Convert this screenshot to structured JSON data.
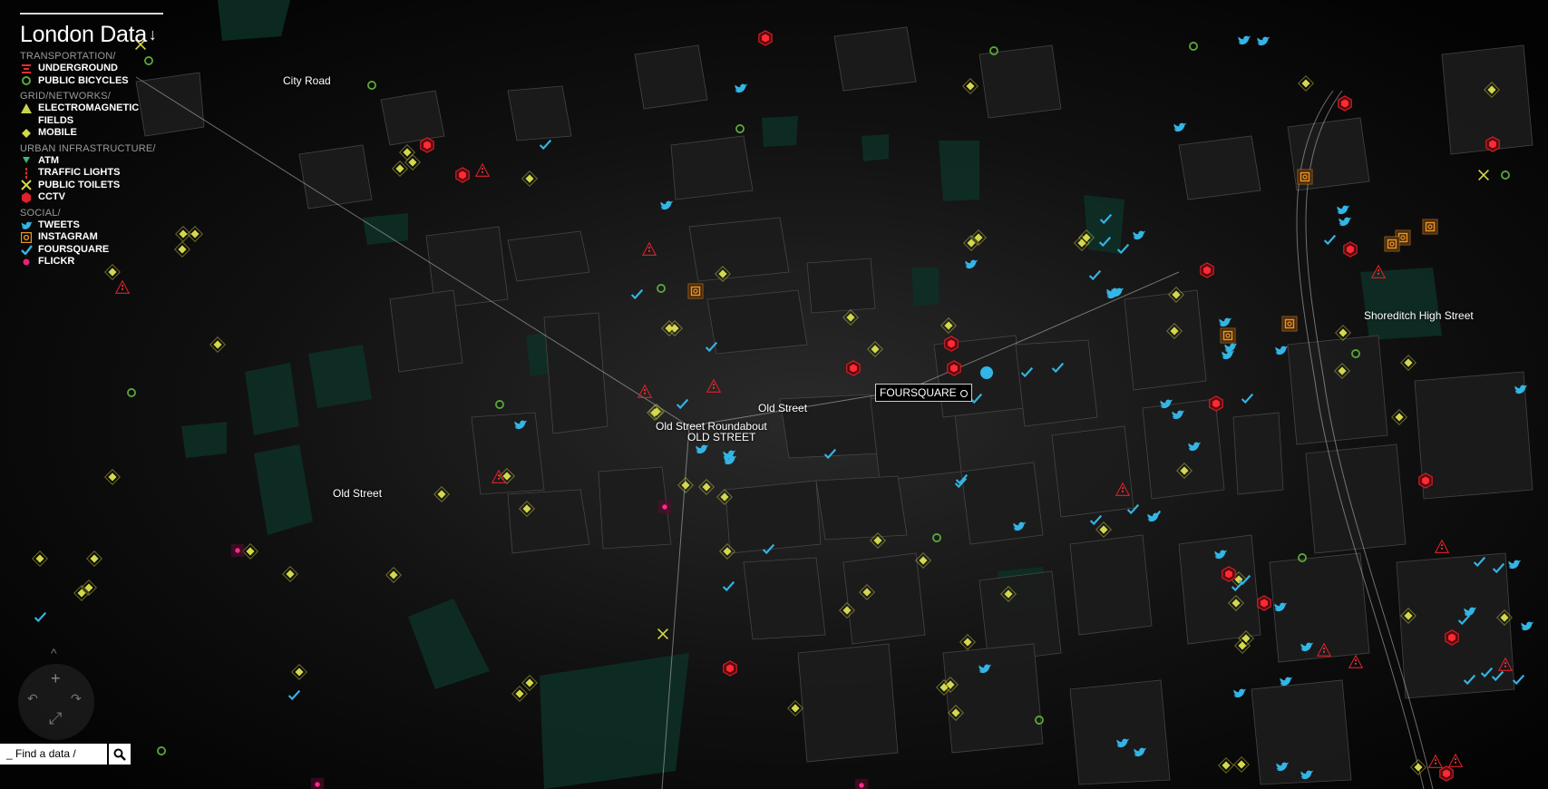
{
  "title": "London Data",
  "title_arrow": "↓",
  "legend": {
    "categories": [
      {
        "name": "TRANSPORTATION/",
        "items": [
          {
            "label": "UNDERGROUND",
            "icon": "underground-icon",
            "color": "#e03030"
          },
          {
            "label": "PUBLIC BICYCLES",
            "icon": "bicycle-icon",
            "color": "#5aa83a"
          }
        ]
      },
      {
        "name": "GRID/NETWORKS/",
        "items": [
          {
            "label": "ELECTROMAGNETIC FIELDS",
            "icon": "triangle-icon",
            "color": "#c8d34a"
          },
          {
            "label": "MOBILE",
            "icon": "diamond-icon",
            "color": "#d4d84a"
          }
        ]
      },
      {
        "name": "URBAN INFRASTRUCTURE/",
        "items": [
          {
            "label": "ATM",
            "icon": "atm-icon",
            "color": "#3cb878"
          },
          {
            "label": "TRAFFIC LIGHTS",
            "icon": "traffic-light-icon",
            "color": "#e03030"
          },
          {
            "label": "PUBLIC TOILETS",
            "icon": "toilet-x-icon",
            "color": "#d4d84a"
          },
          {
            "label": "CCTV",
            "icon": "cctv-hexagon-icon",
            "color": "#e0202a"
          }
        ]
      },
      {
        "name": "SOCIAL/",
        "items": [
          {
            "label": "TWEETS",
            "icon": "twitter-bird-icon",
            "color": "#33b5e5"
          },
          {
            "label": "INSTAGRAM",
            "icon": "instagram-icon",
            "color": "#e8962a"
          },
          {
            "label": "FOURSQUARE",
            "icon": "foursquare-check-icon",
            "color": "#33b5e5"
          },
          {
            "label": "FLICKR",
            "icon": "flickr-dot-icon",
            "color": "#e8207a"
          }
        ]
      }
    ]
  },
  "map": {
    "labels": {
      "city_road": "City Road",
      "old_street_1": "Old Street",
      "old_street_2": "Old Street",
      "roundabout": "Old Street Roundabout",
      "station": "OLD STREET",
      "shoreditch": "Shoreditch High Street",
      "foursquare": "FOURSQUARE"
    }
  },
  "nav": {
    "up": "^",
    "zoom_in": "+",
    "rotate_left": "↶",
    "rotate_right": "↷",
    "fullscreen": "⤢"
  },
  "search": {
    "placeholder": "_ Find a data /",
    "icon": "search-icon"
  }
}
